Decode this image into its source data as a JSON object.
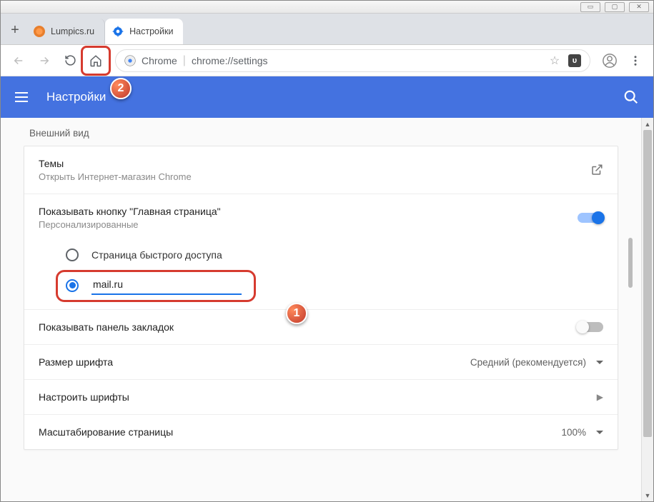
{
  "tabs": [
    {
      "label": "Lumpics.ru"
    },
    {
      "label": "Настройки"
    }
  ],
  "address": {
    "host": "Chrome",
    "path": "chrome://settings"
  },
  "appbar": {
    "title": "Настройки"
  },
  "section": {
    "title": "Внешний вид"
  },
  "themes": {
    "title": "Темы",
    "subtitle": "Открыть Интернет-магазин Chrome"
  },
  "homebtn": {
    "title": "Показывать кнопку \"Главная страница\"",
    "subtitle": "Персонализированные",
    "radio1": "Страница быстрого доступа",
    "url_value": "mail.ru"
  },
  "bookmarks": {
    "title": "Показывать панель закладок"
  },
  "fontsize": {
    "title": "Размер шрифта",
    "value": "Средний (рекомендуется)"
  },
  "fonts": {
    "title": "Настроить шрифты"
  },
  "zoom": {
    "title": "Масштабирование страницы",
    "value": "100%"
  },
  "annotations": {
    "b1": "1",
    "b2": "2"
  }
}
